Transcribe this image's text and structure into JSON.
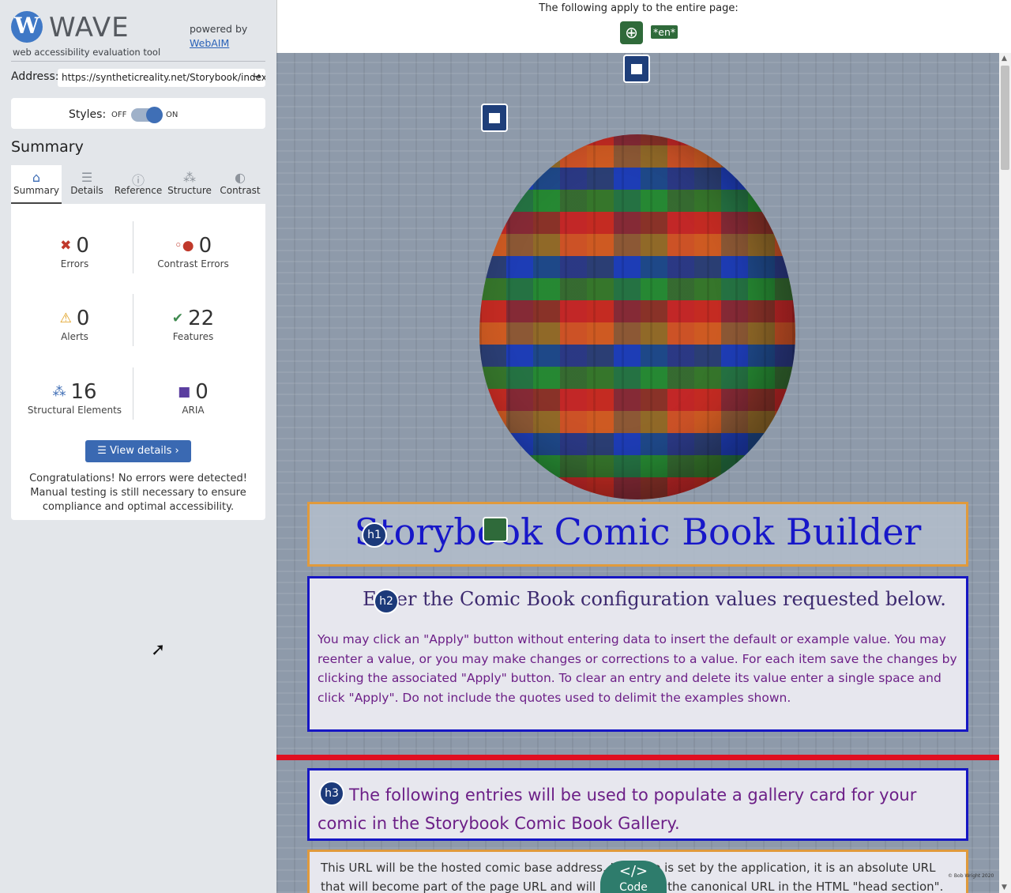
{
  "sidebar": {
    "logo_letter": "W",
    "logo_word": "WAVE",
    "logo_sub": "web accessibility evaluation tool",
    "powered_by": "powered by",
    "powered_link": "WebAIM",
    "address_label": "Address:",
    "address_value": "https://syntheticreality.net/Storybook/index.",
    "styles_label": "Styles:",
    "styles_off": "OFF",
    "styles_on": "ON",
    "styles_enabled": true,
    "summary_heading": "Summary",
    "tabs": [
      {
        "label": "Summary",
        "icon": "home-icon",
        "glyph": "⌂",
        "active": true
      },
      {
        "label": "Details",
        "icon": "list-icon",
        "glyph": "☰",
        "active": false
      },
      {
        "label": "Reference",
        "icon": "info-icon",
        "glyph": "ⓘ",
        "active": false
      },
      {
        "label": "Structure",
        "icon": "hierarchy-icon",
        "glyph": "⁂",
        "active": false
      },
      {
        "label": "Contrast",
        "icon": "contrast-icon",
        "glyph": "◐",
        "active": false
      }
    ],
    "stats": {
      "errors": {
        "value": "0",
        "label": "Errors",
        "color": "#c0392b"
      },
      "contrast_errors": {
        "value": "0",
        "label": "Contrast Errors",
        "color": "#c0392b"
      },
      "alerts": {
        "value": "0",
        "label": "Alerts",
        "color": "#e0a020"
      },
      "features": {
        "value": "22",
        "label": "Features",
        "color": "#3f8a4f"
      },
      "structural": {
        "value": "16",
        "label": "Structural Elements",
        "color": "#3c6bb4"
      },
      "aria": {
        "value": "0",
        "label": "ARIA",
        "color": "#5b3ea0"
      }
    },
    "view_details": "View details ›",
    "congrats": "Congratulations! No errors were detected! Manual testing is still necessary to ensure compliance and optimal accessibility."
  },
  "topbar": {
    "text": "The following apply to the entire page:",
    "lang_tag": "*en*"
  },
  "page": {
    "h1_badge": "h1",
    "h1_text": "Storybook Comic Book Builder",
    "h2_badge": "h2",
    "h2_text": "Enter the Comic Book configuration values requested below.",
    "para2": "You may click an \"Apply\" button without entering data to insert the default or example value. You may reenter a value, or you may make changes or corrections to a value. For each item save the changes by clicking the associated \"Apply\" button. To clear an entry and delete its value enter a single space and click \"Apply\". Do not include the quotes used to delimit the examples shown.",
    "h3_badge": "h3",
    "h3_text": "The following entries will be used to populate a gallery card for your comic in the Storybook Comic Book Gallery.",
    "para4": "This URL will be the hosted comic base address. Its value is set by the application, it is an absolute URL that will become part of the page URL and will be used as the canonical URL in the HTML \"head section\". It",
    "code_icon": "</>",
    "code_label": "Code",
    "copyright": "© Bob Wright 2020"
  },
  "colors": {
    "accent": "#3a69b2",
    "h1_color": "#1717c9",
    "paragraph_purple": "#6c1f87",
    "feature_green": "#2f6a3a",
    "divider_red": "#e01020"
  }
}
